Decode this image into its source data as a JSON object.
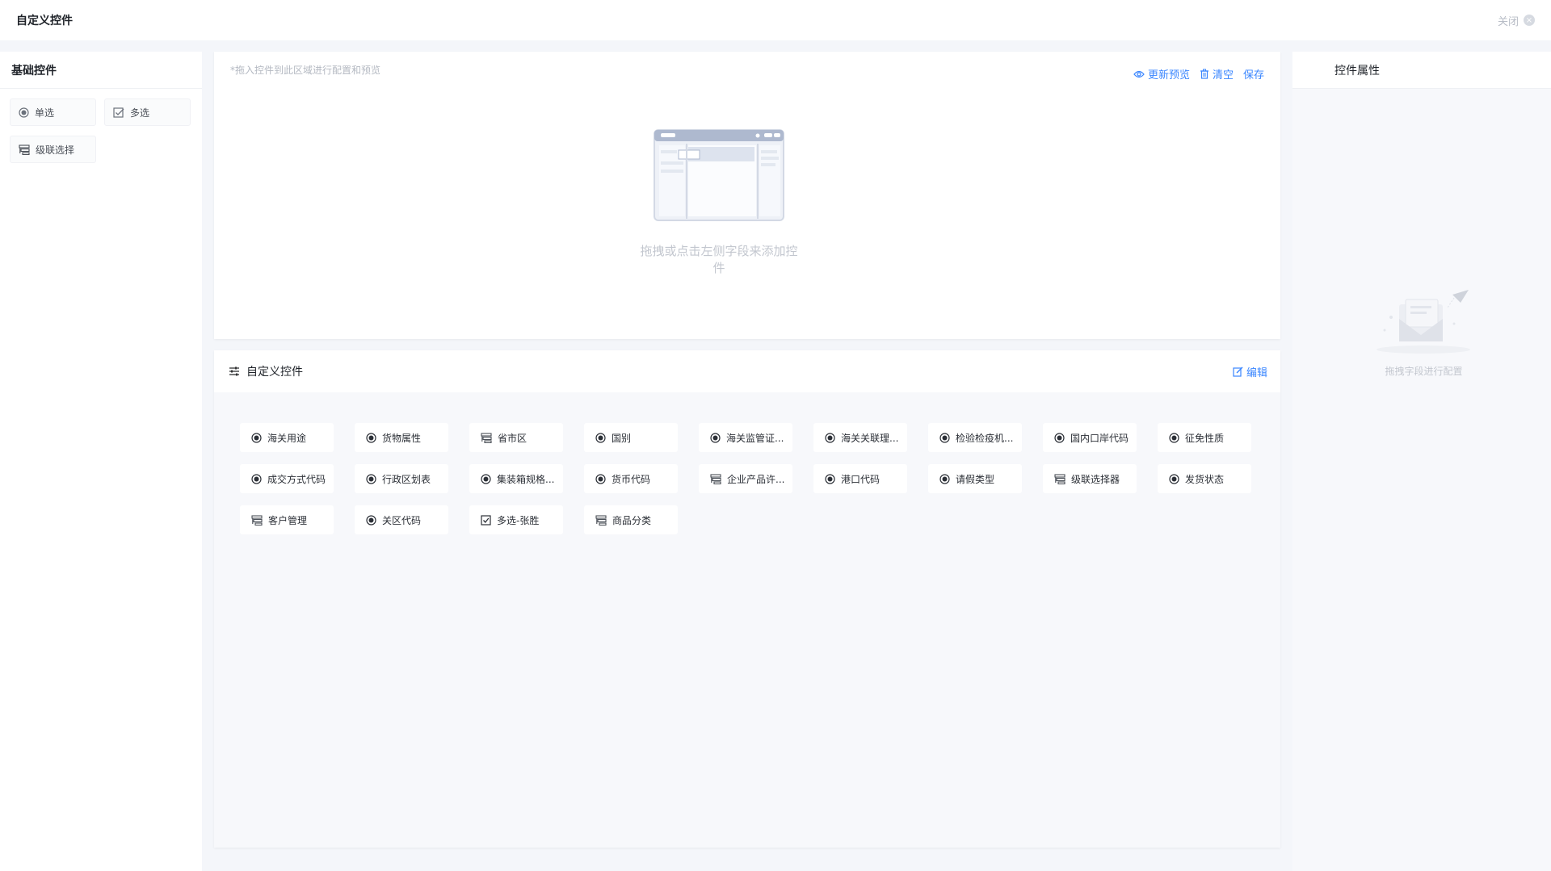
{
  "header": {
    "title": "自定义控件",
    "close_label": "关闭"
  },
  "left_panel": {
    "title": "基础控件",
    "items": [
      {
        "label": "单选",
        "icon": "radio-icon"
      },
      {
        "label": "多选",
        "icon": "checkbox-icon"
      },
      {
        "label": "级联选择",
        "icon": "cascade-icon"
      }
    ]
  },
  "canvas": {
    "hint": "*拖入控件到此区域进行配置和预览",
    "actions": [
      {
        "label": "更新预览",
        "icon": "eye-icon"
      },
      {
        "label": "清空",
        "icon": "trash-icon"
      },
      {
        "label": "保存",
        "icon": ""
      }
    ],
    "empty_text": "拖拽或点击左侧字段来添加控件"
  },
  "custom_section": {
    "title": "自定义控件",
    "edit_label": "编辑",
    "items": [
      {
        "label": "海关用途",
        "icon": "radio-icon"
      },
      {
        "label": "货物属性",
        "icon": "radio-icon"
      },
      {
        "label": "省市区",
        "icon": "cascade-icon"
      },
      {
        "label": "国别",
        "icon": "radio-icon"
      },
      {
        "label": "海关监管证...",
        "icon": "radio-icon"
      },
      {
        "label": "海关关联理...",
        "icon": "radio-icon"
      },
      {
        "label": "检验检疫机...",
        "icon": "radio-icon"
      },
      {
        "label": "国内口岸代码",
        "icon": "radio-icon"
      },
      {
        "label": "征免性质",
        "icon": "radio-icon"
      },
      {
        "label": "成交方式代码",
        "icon": "radio-icon"
      },
      {
        "label": "行政区划表",
        "icon": "radio-icon"
      },
      {
        "label": "集装箱规格...",
        "icon": "radio-icon"
      },
      {
        "label": "货币代码",
        "icon": "radio-icon"
      },
      {
        "label": "企业产品许...",
        "icon": "cascade-icon"
      },
      {
        "label": "港口代码",
        "icon": "radio-icon"
      },
      {
        "label": "请假类型",
        "icon": "radio-icon"
      },
      {
        "label": "级联选择器",
        "icon": "cascade-icon"
      },
      {
        "label": "发货状态",
        "icon": "radio-icon"
      },
      {
        "label": "客户管理",
        "icon": "cascade-icon"
      },
      {
        "label": "关区代码",
        "icon": "radio-icon"
      },
      {
        "label": "多选-张胜",
        "icon": "checkbox-checked-icon"
      },
      {
        "label": "商品分类",
        "icon": "cascade-icon"
      }
    ]
  },
  "right_panel": {
    "title": "控件属性",
    "empty_text": "拖拽字段进行配置"
  },
  "colors": {
    "accent": "#3a86ff",
    "muted": "#c3c7cf"
  }
}
